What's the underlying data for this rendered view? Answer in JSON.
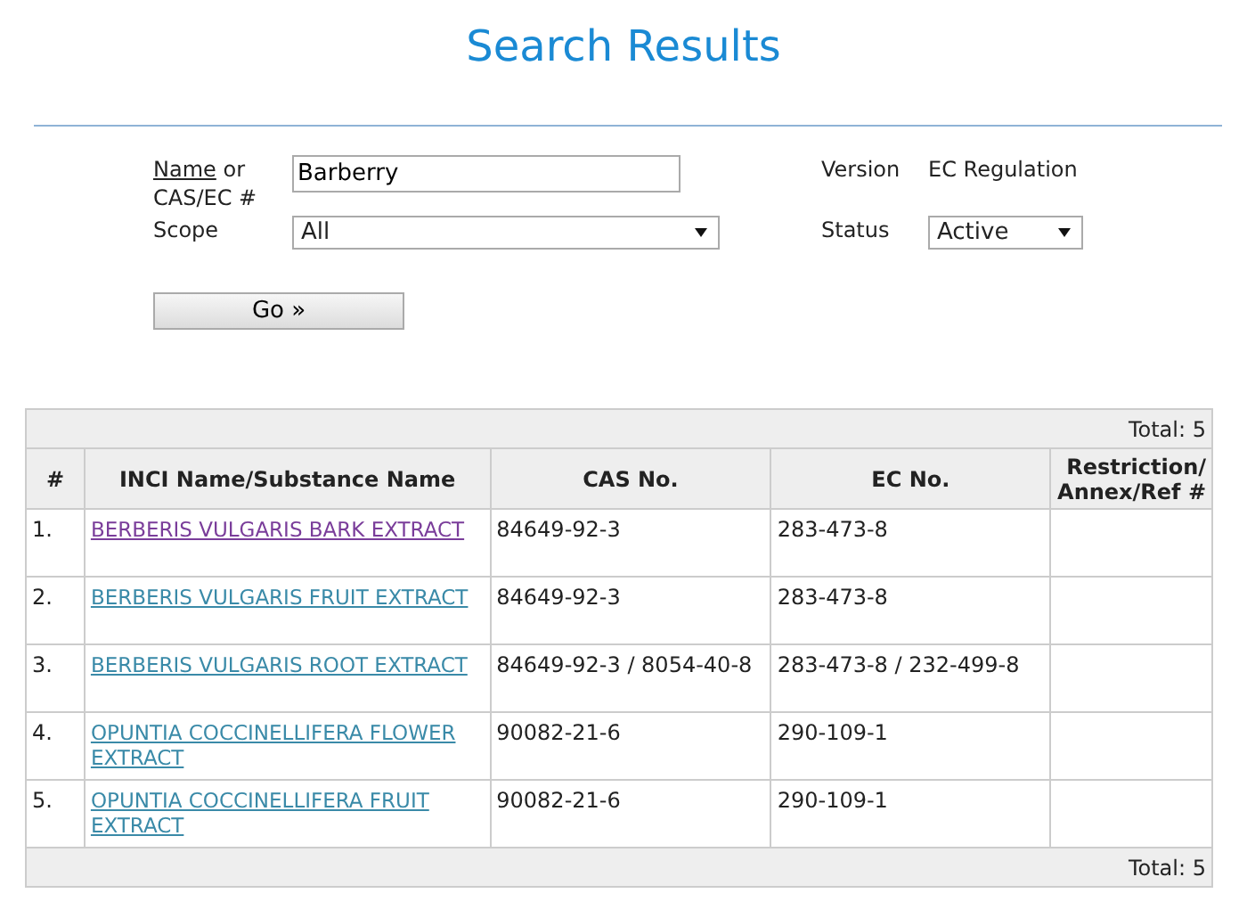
{
  "title": "Search Results",
  "form": {
    "name_label": {
      "access_word": "Name",
      "rest": "or CAS/EC #"
    },
    "name_value": "Barberry",
    "scope_label": "Scope",
    "scope_value": "All",
    "version_label": "Version",
    "version_value": "EC Regulation",
    "status_label": "Status",
    "status_value": "Active",
    "go_button": "Go »"
  },
  "table": {
    "total_top": "Total: 5",
    "total_bottom": "Total: 5",
    "columns": [
      "#",
      "INCI Name/Substance Name",
      "CAS No.",
      "EC No.",
      "Restriction/ Annex/Ref #"
    ],
    "rows": [
      {
        "number": "1.",
        "name": "BERBERIS VULGARIS BARK EXTRACT",
        "visited": true,
        "cas": "84649-92-3",
        "ec": "283-473-8"
      },
      {
        "number": "2.",
        "name": "BERBERIS VULGARIS FRUIT EXTRACT",
        "visited": false,
        "cas": "84649-92-3",
        "ec": "283-473-8"
      },
      {
        "number": "3.",
        "name": "BERBERIS VULGARIS ROOT EXTRACT",
        "visited": false,
        "cas": "84649-92-3 / 8054-40-8",
        "ec": "283-473-8 / 232-499-8"
      },
      {
        "number": "4.",
        "name": "OPUNTIA COCCINELLIFERA FLOWER EXTRACT",
        "visited": false,
        "cas": "90082-21-6",
        "ec": "290-109-1"
      },
      {
        "number": "5.",
        "name": "OPUNTIA COCCINELLIFERA FRUIT EXTRACT",
        "visited": false,
        "cas": "90082-21-6",
        "ec": "290-109-1"
      }
    ]
  }
}
